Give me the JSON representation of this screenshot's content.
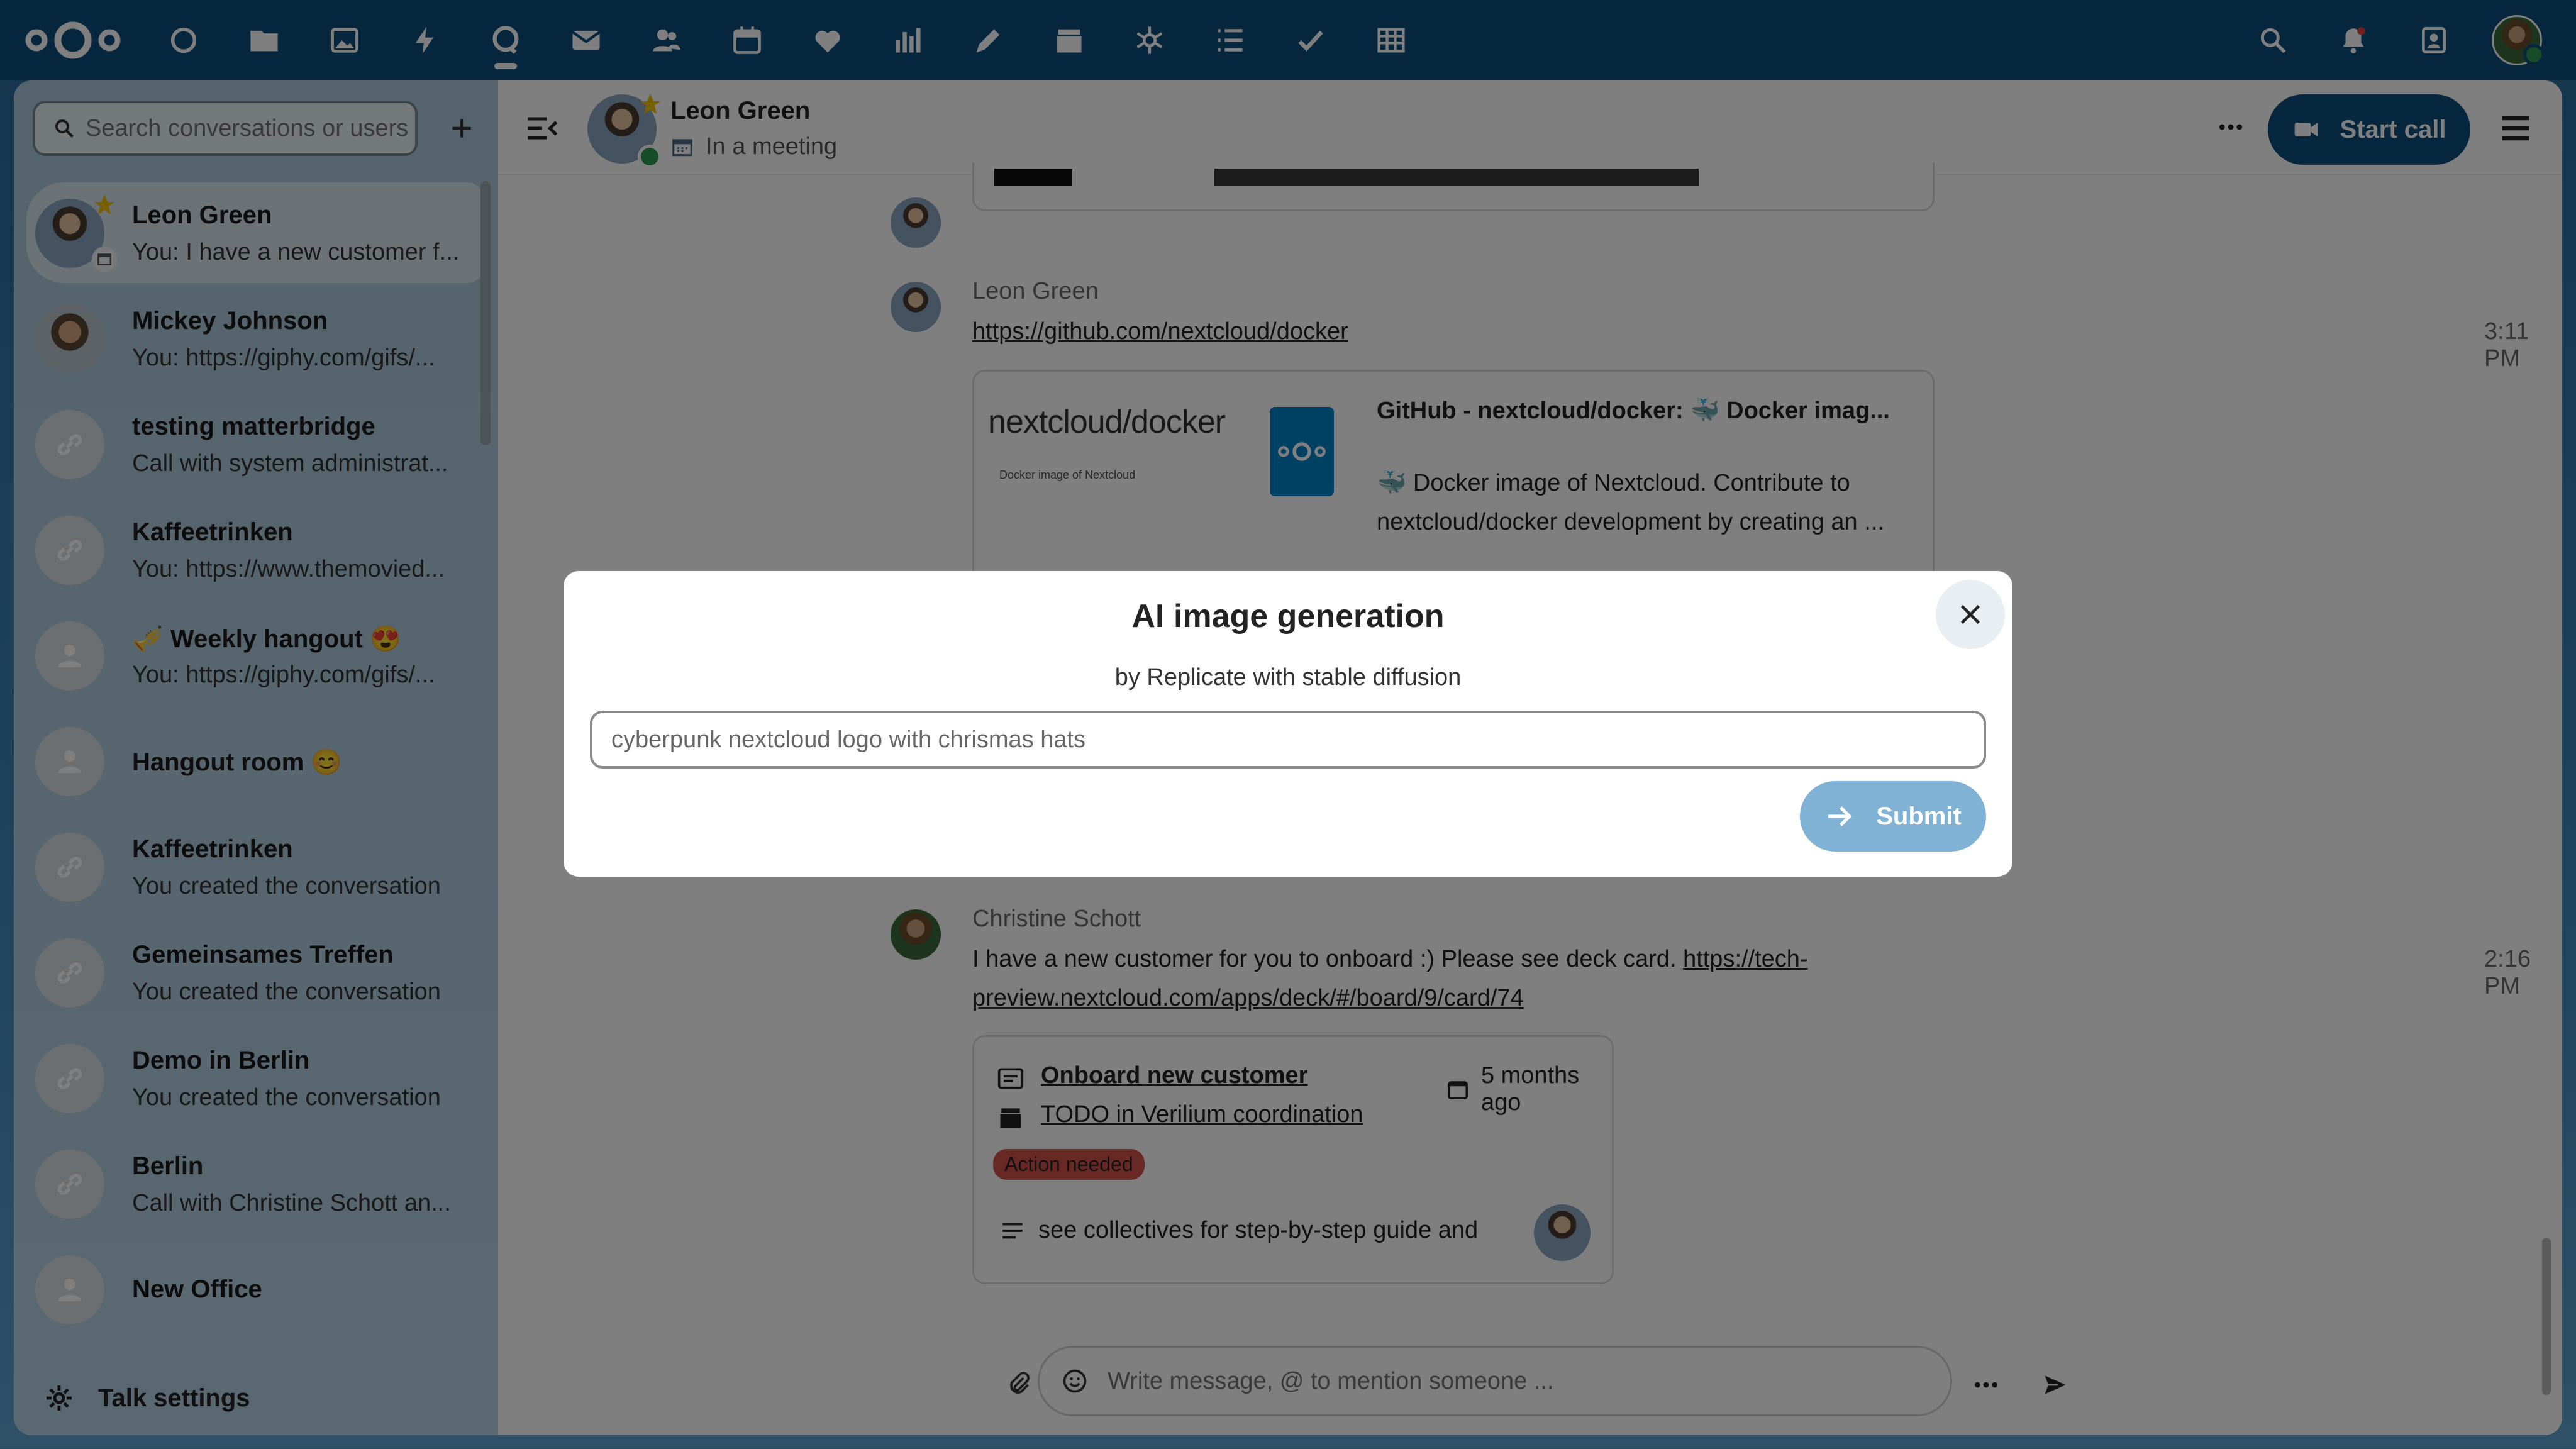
{
  "header": {
    "app_icons": [
      "dashboard-icon",
      "files-icon",
      "photos-icon",
      "activity-icon",
      "talk-icon",
      "mail-icon",
      "contacts-icon",
      "calendar-icon",
      "health-icon",
      "analytics-icon",
      "notes-icon",
      "deck-icon",
      "cospend-icon",
      "tasks-list-icon",
      "checklist-icon",
      "tables-icon"
    ],
    "right_icons": [
      "search-icon",
      "notifications-icon",
      "contacts-menu-icon"
    ]
  },
  "sidebar": {
    "search_placeholder": "Search conversations or users",
    "conversations": [
      {
        "title": "Leon Green",
        "subtitle": "You: I have a new customer f...",
        "active": true
      },
      {
        "title": "Mickey Johnson",
        "subtitle": "You: https://giphy.com/gifs/..."
      },
      {
        "title": "testing matterbridge",
        "subtitle": "Call with system administrat..."
      },
      {
        "title": "Kaffeetrinken",
        "subtitle": "You: https://www.themovied..."
      },
      {
        "title": "🎺 Weekly hangout 😍",
        "subtitle": "You: https://giphy.com/gifs/..."
      },
      {
        "title": "Hangout room 😊",
        "subtitle": ""
      },
      {
        "title": "Kaffeetrinken",
        "subtitle": "You created the conversation"
      },
      {
        "title": "Gemeinsames Treffen",
        "subtitle": "You created the conversation"
      },
      {
        "title": "Demo in Berlin",
        "subtitle": "You created the conversation"
      },
      {
        "title": "Berlin",
        "subtitle": "Call with Christine Schott an..."
      },
      {
        "title": "New Office",
        "subtitle": ""
      }
    ],
    "settings_label": "Talk settings"
  },
  "chat": {
    "contact_name": "Leon Green",
    "contact_status": "In a meeting",
    "start_call_label": "Start call",
    "messages": [
      {
        "author": "Leon Green",
        "link": "https://github.com/nextcloud/docker",
        "time": "3:11 PM",
        "preview": {
          "image_title": "nextcloud/docker",
          "image_subtitle": "Docker image of Nextcloud",
          "title": "GitHub - nextcloud/docker: 🐳 Docker imag...",
          "description": "🐳 Docker image of Nextcloud. Contribute to nextcloud/docker development by creating an ..."
        }
      },
      {
        "author": "Christine Schott",
        "text": "I have a new customer for you to onboard :) Please see deck card. ",
        "link_part1": "https://tech-",
        "link_part2": "preview.nextcloud.com/apps/deck/#/board/9/card/74",
        "time": "2:16 PM",
        "deck_card": {
          "title": "Onboard new customer",
          "due": "5 months ago",
          "board": "TODO in Verilium coordination",
          "label": "Action needed",
          "description": "see collectives for step-by-step guide and"
        }
      }
    ],
    "composer_placeholder": "Write message, @ to mention someone ..."
  },
  "modal": {
    "title": "AI image generation",
    "subtitle": "by Replicate with stable diffusion",
    "prompt_value": "cyberpunk nextcloud logo with chrismas hats",
    "submit_label": "Submit"
  }
}
